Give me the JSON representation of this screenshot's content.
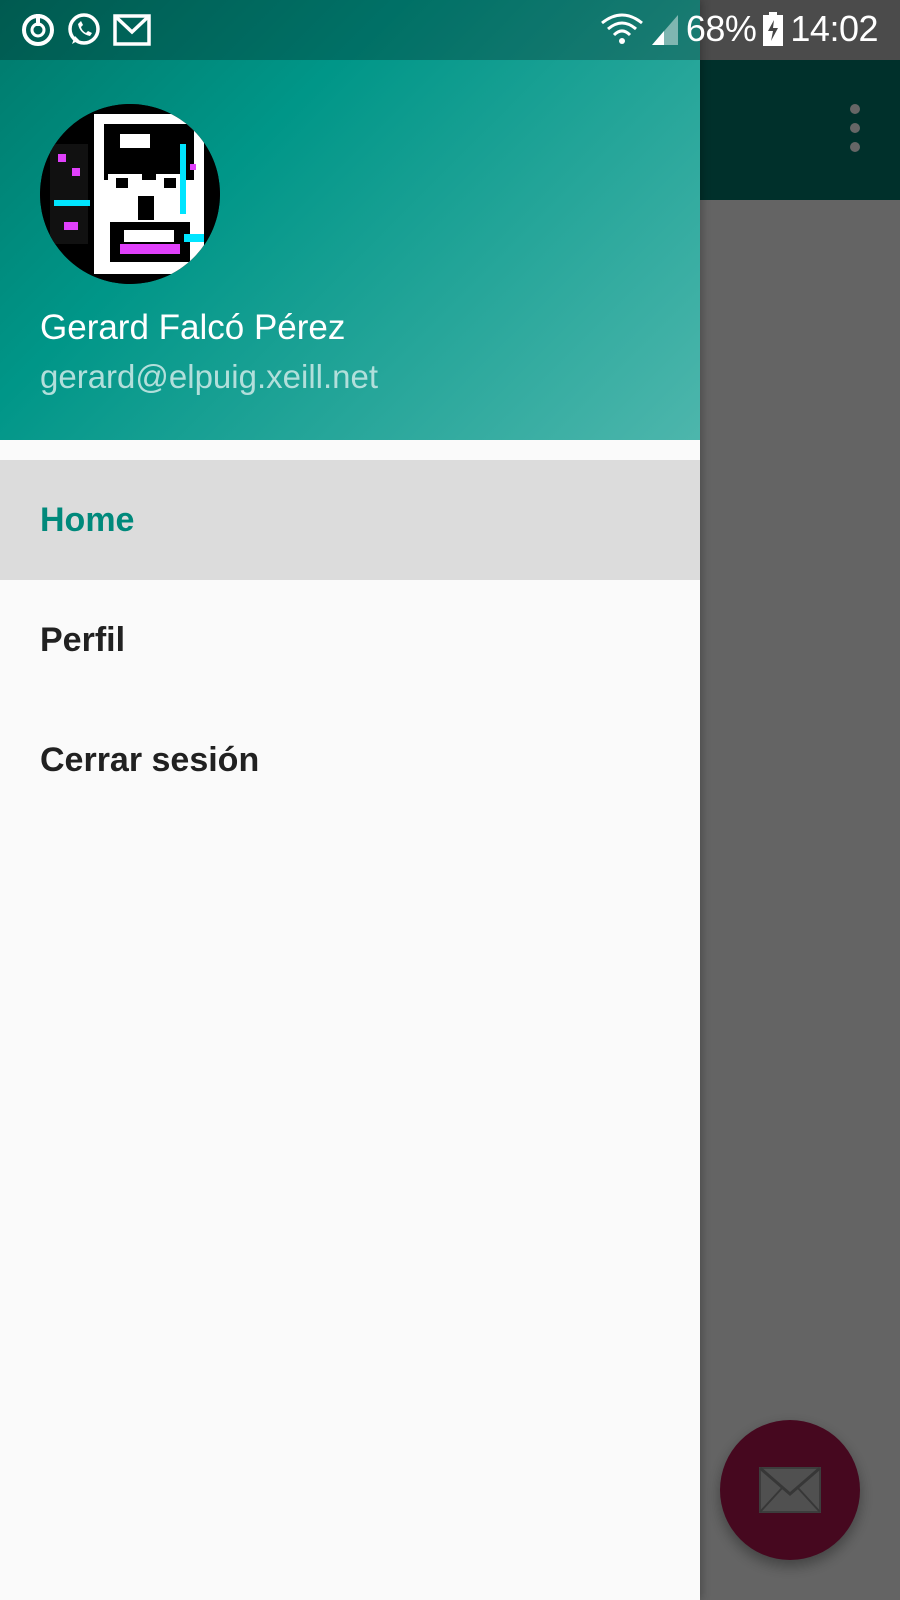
{
  "status_bar": {
    "battery": "68%",
    "time": "14:02",
    "left_icons": [
      "sync-icon",
      "whatsapp-icon",
      "gmail-icon"
    ],
    "right_icons": [
      "wifi-icon",
      "signal-icon",
      "battery-icon"
    ]
  },
  "drawer": {
    "header": {
      "name": "Gerard Falcó Pérez",
      "email": "gerard@elpuig.xeill.net"
    },
    "menu": [
      {
        "label": "Home",
        "active": true
      },
      {
        "label": "Perfil",
        "active": false
      },
      {
        "label": "Cerrar sesión",
        "active": false
      }
    ]
  },
  "app": {
    "toolbar_icon": "more-vert-icon",
    "fab_icon": "mail-icon"
  },
  "colors": {
    "primary": "#00796b",
    "accent": "#b0154f",
    "active_text": "#00897b",
    "active_bg": "#dcdcdc"
  }
}
